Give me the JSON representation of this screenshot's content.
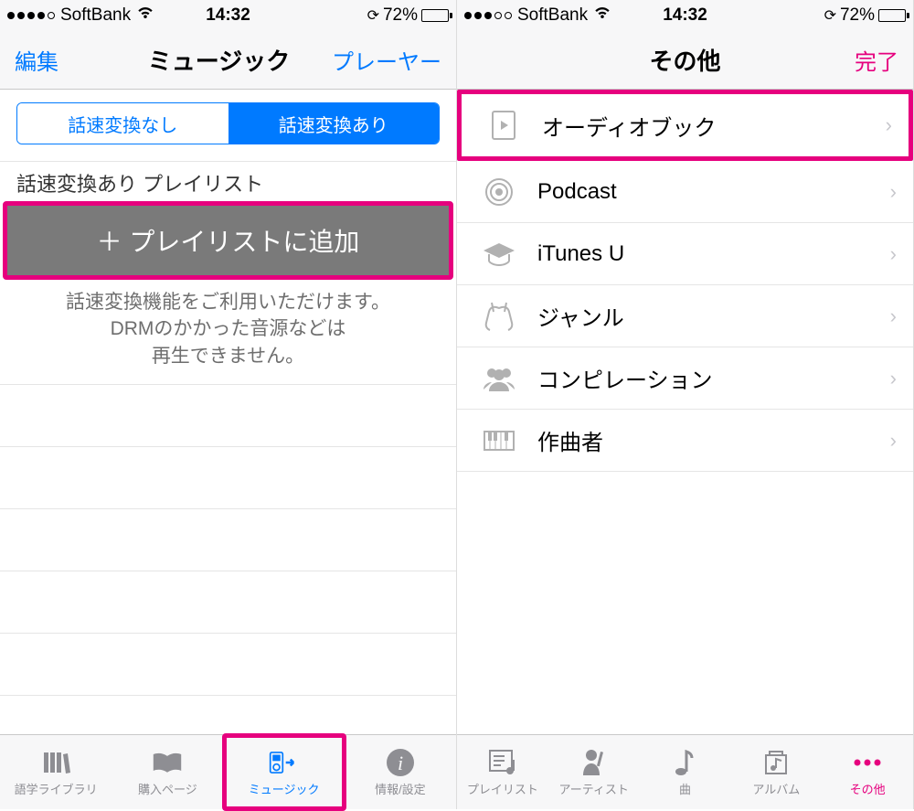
{
  "status": {
    "carrier": "SoftBank",
    "time": "14:32",
    "battery_pct": "72%"
  },
  "left": {
    "nav": {
      "left": "編集",
      "title": "ミュージック",
      "right": "プレーヤー"
    },
    "segmented": {
      "off": "話速変換なし",
      "on": "話速変換あり"
    },
    "section_header": "話速変換あり プレイリスト",
    "add_playlist": "＋ プレイリストに追加",
    "info_line1": "話速変換機能をご利用いただけます。",
    "info_line2": "DRMのかかった音源などは",
    "info_line3": "再生できません。",
    "tabs": [
      {
        "label": "語学ライブラリ",
        "icon": "library"
      },
      {
        "label": "購入ページ",
        "icon": "book-open"
      },
      {
        "label": "ミュージック",
        "icon": "ipod-arrow",
        "active": true,
        "highlighted": true
      },
      {
        "label": "情報/設定",
        "icon": "info"
      }
    ]
  },
  "right": {
    "nav": {
      "left": "",
      "title": "その他",
      "right": "完了"
    },
    "rows": [
      {
        "label": "オーディオブック",
        "icon": "audiobook",
        "highlighted": true
      },
      {
        "label": "Podcast",
        "icon": "podcast"
      },
      {
        "label": "iTunes U",
        "icon": "gradcap"
      },
      {
        "label": "ジャンル",
        "icon": "guitar"
      },
      {
        "label": "コンピレーション",
        "icon": "people"
      },
      {
        "label": "作曲者",
        "icon": "piano"
      }
    ],
    "tabs": [
      {
        "label": "プレイリスト",
        "icon": "playlist"
      },
      {
        "label": "アーティスト",
        "icon": "artist"
      },
      {
        "label": "曲",
        "icon": "song"
      },
      {
        "label": "アルバム",
        "icon": "album"
      },
      {
        "label": "その他",
        "icon": "more",
        "pink": true
      }
    ]
  }
}
